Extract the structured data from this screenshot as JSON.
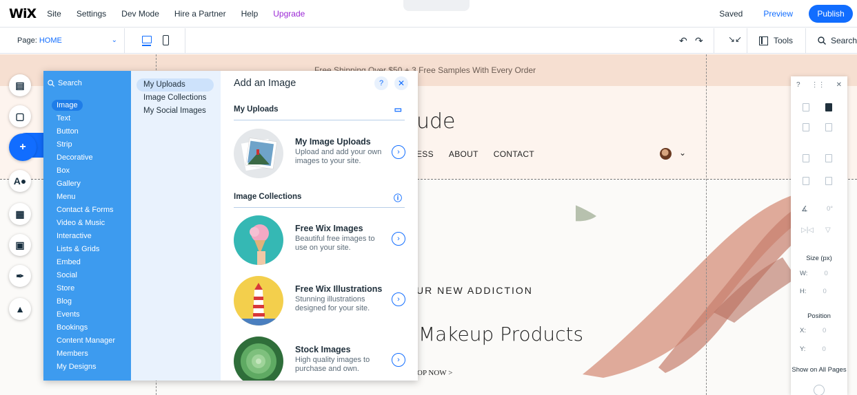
{
  "topbar": {
    "logo": "WiX",
    "menu": [
      "Site",
      "Settings",
      "Dev Mode",
      "Hire a Partner",
      "Help",
      "Upgrade"
    ],
    "saved": "Saved",
    "preview": "Preview",
    "publish": "Publish"
  },
  "secbar": {
    "page_label": "Page:",
    "page_name": "HOME",
    "tools": "Tools",
    "search": "Search"
  },
  "site": {
    "announcement": "Free Shipping Over $50 + 3 Free Samples With Every Order",
    "brand_partial": "ude",
    "nav": [
      "ESS",
      "ABOUT",
      "CONTACT"
    ],
    "tagline": "UR NEW ADDICTION",
    "headline": "Makeup Products",
    "shop": "OP NOW >"
  },
  "add_panel": {
    "search": "Search",
    "categories": [
      "Image",
      "Text",
      "Button",
      "Strip",
      "Decorative",
      "Box",
      "Gallery",
      "Menu",
      "Contact & Forms",
      "Video & Music",
      "Interactive",
      "Lists & Grids",
      "Embed",
      "Social",
      "Store",
      "Blog",
      "Events",
      "Bookings",
      "Content Manager",
      "Members",
      "My Designs"
    ],
    "selected_category": "Image",
    "subcategories": [
      "My Uploads",
      "Image Collections",
      "My Social Images"
    ],
    "selected_subcategory": "My Uploads",
    "title": "Add an Image",
    "sections": {
      "uploads": "My Uploads",
      "collections": "Image Collections"
    },
    "items": [
      {
        "name": "My Image Uploads",
        "desc": "Upload and add your own images to your site."
      },
      {
        "name": "Free Wix Images",
        "desc": "Beautiful free images to use on your site."
      },
      {
        "name": "Free Wix Illustrations",
        "desc": "Stunning illustrations designed for your site."
      },
      {
        "name": "Stock Images",
        "desc": "High quality images to purchase and own."
      }
    ]
  },
  "right_panel": {
    "help": "?",
    "rotation": "0°",
    "size_label": "Size (px)",
    "w_label": "W:",
    "w_value": "0",
    "h_label": "H:",
    "h_value": "0",
    "position_label": "Position",
    "x_label": "X:",
    "x_value": "0",
    "y_label": "Y:",
    "y_value": "0",
    "show_all": "Show on All Pages"
  }
}
